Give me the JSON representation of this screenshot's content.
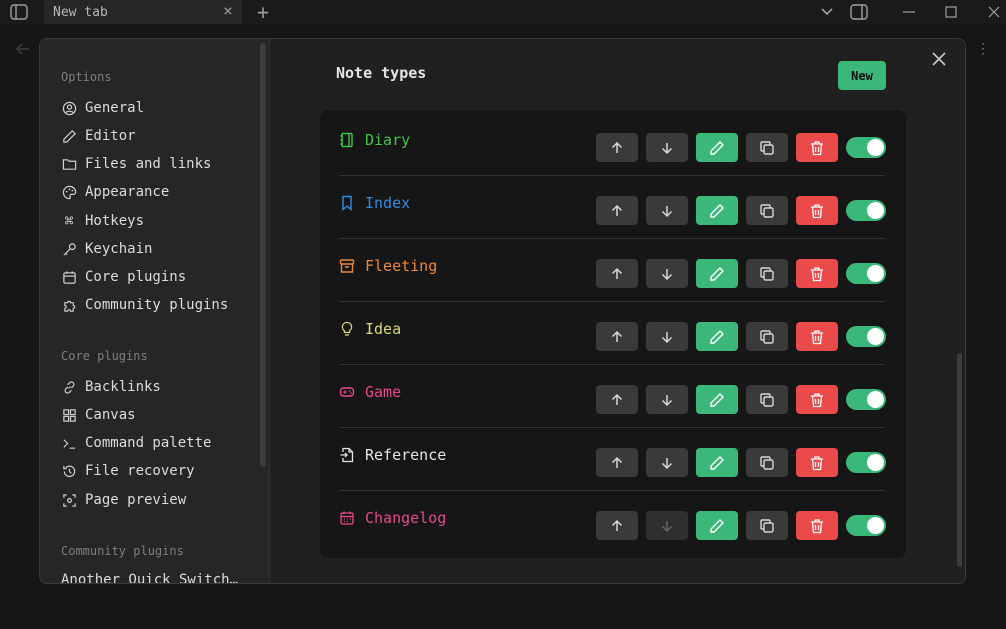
{
  "window": {
    "tab_title": "New tab"
  },
  "modal": {
    "sidebar": {
      "groups": [
        {
          "label": "Options",
          "items": [
            {
              "label": "General",
              "icon": "user-circle-icon"
            },
            {
              "label": "Editor",
              "icon": "pencil-icon"
            },
            {
              "label": "Files and links",
              "icon": "folder-icon"
            },
            {
              "label": "Appearance",
              "icon": "palette-icon"
            },
            {
              "label": "Hotkeys",
              "icon": "command-icon"
            },
            {
              "label": "Keychain",
              "icon": "key-icon"
            },
            {
              "label": "Core plugins",
              "icon": "calendar-icon"
            },
            {
              "label": "Community plugins",
              "icon": "puzzle-icon"
            }
          ]
        },
        {
          "label": "Core plugins",
          "items": [
            {
              "label": "Backlinks",
              "icon": "link-icon"
            },
            {
              "label": "Canvas",
              "icon": "layout-icon"
            },
            {
              "label": "Command palette",
              "icon": "terminal-icon"
            },
            {
              "label": "File recovery",
              "icon": "history-icon"
            },
            {
              "label": "Page preview",
              "icon": "scan-eye-icon"
            }
          ]
        },
        {
          "label": "Community plugins",
          "items": [
            {
              "label": "Another Quick Switch…",
              "icon": ""
            }
          ]
        }
      ]
    },
    "content": {
      "title": "Note types",
      "new_button": "New",
      "note_types": [
        {
          "name": "Diary",
          "color": "#3ec44a",
          "icon": "notebook-icon",
          "enabled": true
        },
        {
          "name": "Index",
          "color": "#2f8de4",
          "icon": "bookmark-icon",
          "enabled": true
        },
        {
          "name": "Fleeting",
          "color": "#e8883a",
          "icon": "archive-icon",
          "enabled": true
        },
        {
          "name": "Idea",
          "color": "#d9d77a",
          "icon": "lightbulb-icon",
          "enabled": true
        },
        {
          "name": "Game",
          "color": "#e8478b",
          "icon": "gamepad-icon",
          "enabled": true
        },
        {
          "name": "Reference",
          "color": "#e4e4e4",
          "icon": "file-input-icon",
          "enabled": true
        },
        {
          "name": "Changelog",
          "color": "#e8478b",
          "icon": "calendar-days-icon",
          "enabled": true
        }
      ]
    }
  }
}
